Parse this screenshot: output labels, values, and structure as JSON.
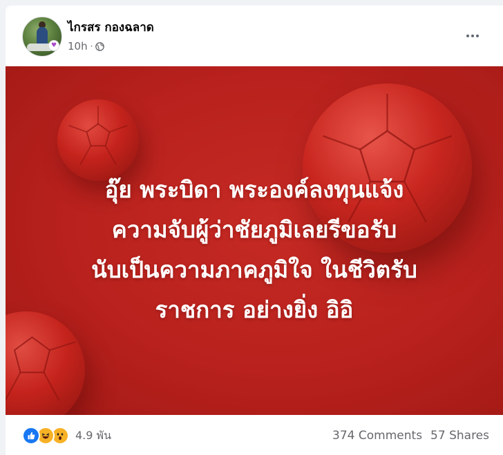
{
  "post": {
    "author": "ไกรสร กองฉลาด",
    "time": "10h",
    "audience_icon": "globe-icon",
    "more_icon": "more-options-icon"
  },
  "image": {
    "background_color": "#b8211d",
    "text_color": "#ffffff",
    "headline_lines": [
      "อุ๊ย พระบิดา พระองค์ลงทุนแจ้ง",
      "ความจับผู้ว่าชัยภูมิเลยรีขอรับ",
      "นับเป็นความภาคภูมิใจ ในชีวิตรับ",
      "ราชการ อย่างยิ่ง อิอิ"
    ]
  },
  "footer": {
    "reaction_icons": [
      "like-icon",
      "haha-icon",
      "wow-icon"
    ],
    "reaction_count": "4.9 พัน",
    "comments": "374 Comments",
    "shares": "57 Shares"
  },
  "colors": {
    "like": "#1877f2",
    "emoji": "#f7b125",
    "secondary_text": "#65676b"
  }
}
